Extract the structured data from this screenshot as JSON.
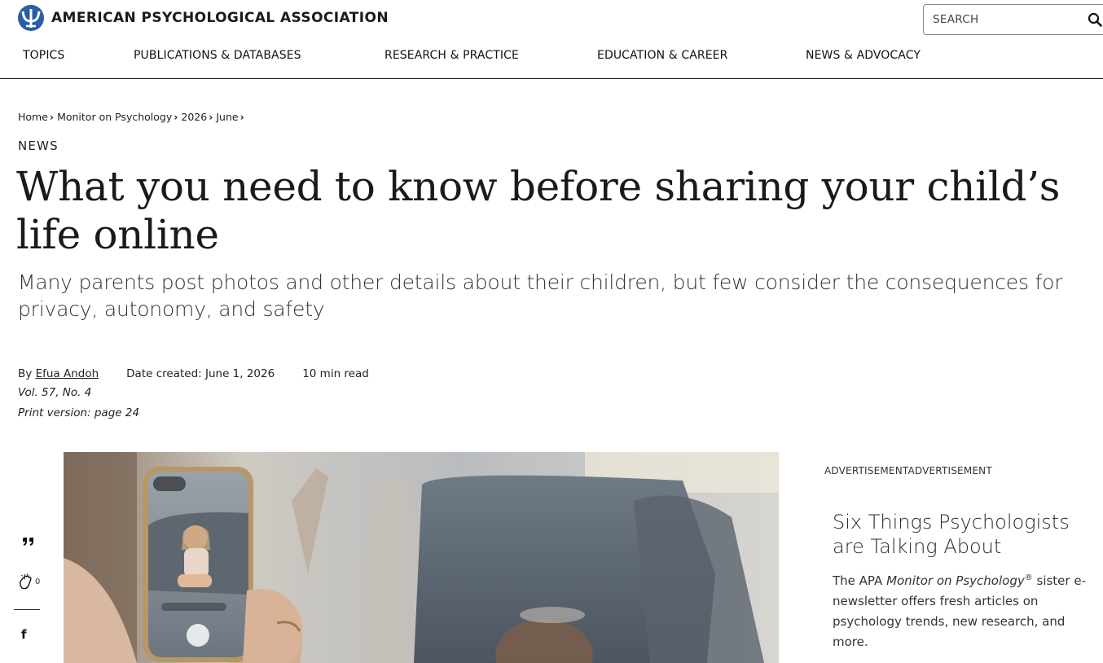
{
  "header": {
    "brand_name": "AMERICAN PSYCHOLOGICAL ASSOCIATION",
    "search_placeholder": "SEARCH",
    "nav": [
      {
        "label": "TOPICS"
      },
      {
        "label": "PUBLICATIONS & DATABASES"
      },
      {
        "label": "RESEARCH & PRACTICE"
      },
      {
        "label": "EDUCATION & CAREER"
      },
      {
        "label": "NEWS & ADVOCACY"
      }
    ]
  },
  "breadcrumb": [
    {
      "label": "Home"
    },
    {
      "label": "Monitor on Psychology"
    },
    {
      "label": "2026"
    },
    {
      "label": "June"
    }
  ],
  "breadcrumb_sep": "›",
  "article": {
    "kicker": "NEWS",
    "title": "What you need to know before sharing your child’s life online",
    "dek": "Many parents post photos and other details about their children, but few consider the consequences for privacy, autonomy, and safety",
    "by_prefix": "By",
    "author": "Efua Andoh",
    "date_created": "Date created: June 1, 2026",
    "read_time": "10 min read",
    "volume": "Vol. 57, No. 4",
    "print_version": "Print version: page 24"
  },
  "share": {
    "clap_count": "0",
    "facebook_glyph": "f"
  },
  "sidebar": {
    "ad_label": "ADVERTISEMENTADVERTISEMENT",
    "promo_title": "Six Things Psychologists are Talking About",
    "promo_body_prefix": "The APA",
    "promo_body_em": "Monitor on Psychology",
    "promo_body_reg": "®",
    "promo_body_suffix": "sister e-newsletter offers fresh articles on psychology trends, new research, and more."
  },
  "colors": {
    "text": "#222222",
    "rule": "#1a1a1a",
    "brand_blue": "#2a5da8"
  },
  "icons": {
    "logo": "apa-psi-logo",
    "search": "search-icon",
    "quote": "quote-icon",
    "clap": "clap-icon",
    "facebook": "facebook-icon"
  }
}
